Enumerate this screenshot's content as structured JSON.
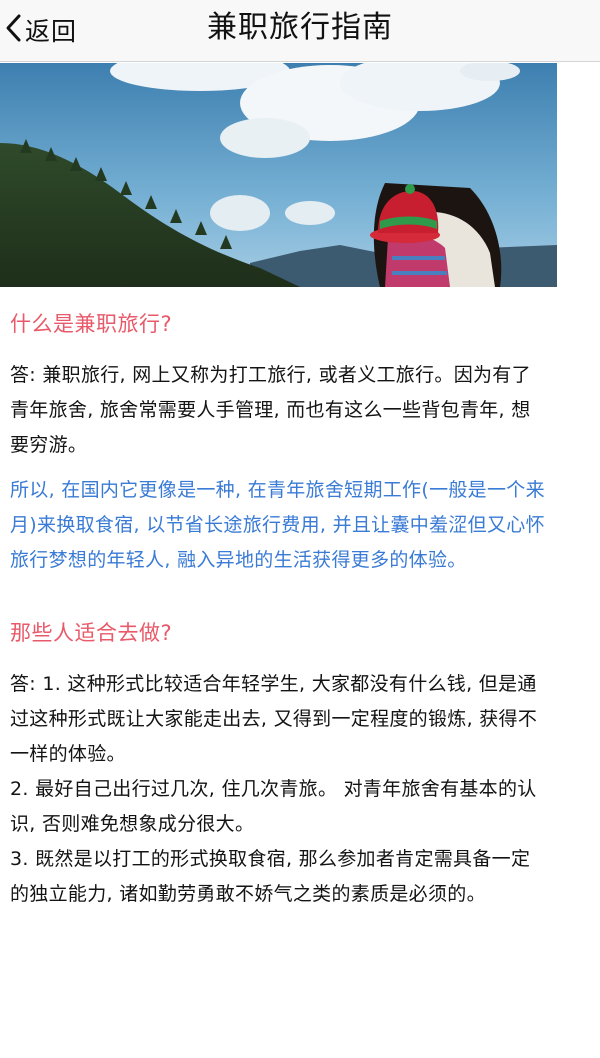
{
  "nav": {
    "back_label": "返回",
    "title": "兼职旅行指南",
    "back_icon": "chevron-left-icon"
  },
  "hero": {
    "image": "traveler-red-hat-mountain-photo"
  },
  "sections": [
    {
      "heading": "什么是兼职旅行?",
      "answer": "答: 兼职旅行, 网上又称为打工旅行, 或者义工旅行。因为有了青年旅舍, 旅舍常需要人手管理, 而也有这么一些背包青年, 想要穷游。",
      "note": "所以, 在国内它更像是一种, 在青年旅舍短期工作(一般是一个来月)来换取食宿, 以节省长途旅行费用, 并且让囊中羞涩但又心怀旅行梦想的年轻人, 融入异地的生活获得更多的体验。"
    },
    {
      "heading": "那些人适合去做?",
      "answer": "答: 1. 这种形式比较适合年轻学生, 大家都没有什么钱, 但是通过这种形式既让大家能走出去, 又得到一定程度的锻炼, 获得不一样的体验。\n2. 最好自己出行过几次, 住几次青旅。 对青年旅舍有基本的认识, 否则难免想象成分很大。\n3. 既然是以打工的形式换取食宿, 那么参加者肯定需具备一定的独立能力, 诸如勤劳勇敢不娇气之类的素质是必须的。"
    }
  ],
  "colors": {
    "heading": "#e85a6a",
    "note": "#3a7bd5",
    "body": "#141414"
  }
}
